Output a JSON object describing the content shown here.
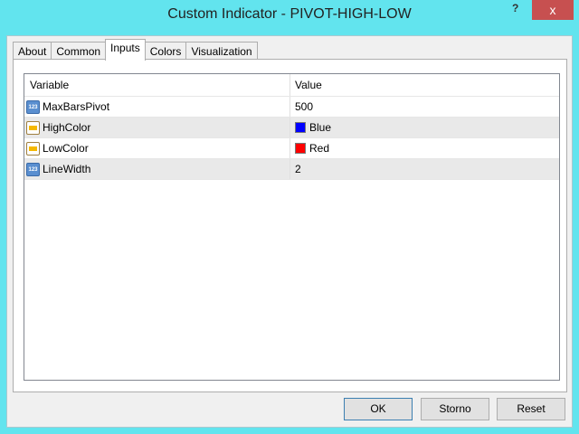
{
  "window": {
    "title": "Custom Indicator - PIVOT-HIGH-LOW",
    "help": "?",
    "close": "x"
  },
  "tabs": [
    {
      "label": "About"
    },
    {
      "label": "Common"
    },
    {
      "label": "Inputs",
      "active": true
    },
    {
      "label": "Colors"
    },
    {
      "label": "Visualization"
    }
  ],
  "table": {
    "headers": {
      "variable": "Variable",
      "value": "Value"
    },
    "rows": [
      {
        "variable": "MaxBarsPivot",
        "value": "500",
        "type": "number",
        "icon_text": "123"
      },
      {
        "variable": "HighColor",
        "value": "Blue",
        "type": "color",
        "swatch": "#0000ff"
      },
      {
        "variable": "LowColor",
        "value": "Red",
        "type": "color",
        "swatch": "#ff0000"
      },
      {
        "variable": "LineWidth",
        "value": "2",
        "type": "number",
        "icon_text": "123"
      }
    ]
  },
  "buttons": {
    "ok": "OK",
    "cancel": "Storno",
    "reset": "Reset"
  }
}
